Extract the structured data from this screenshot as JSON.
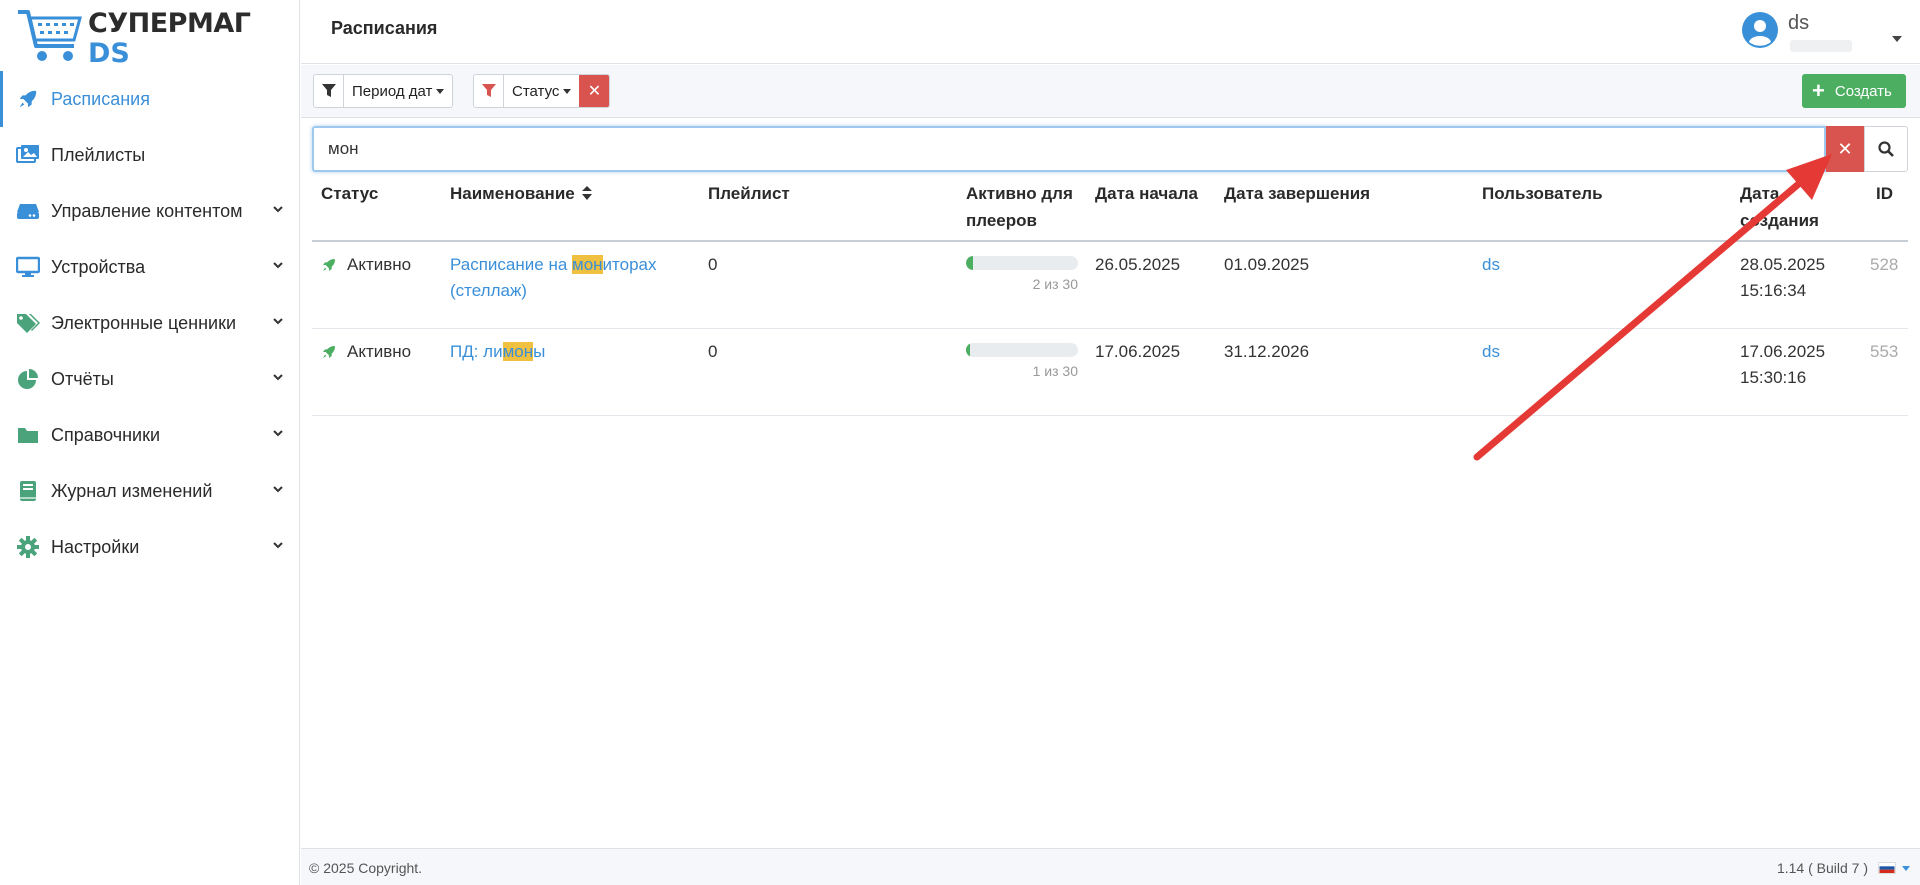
{
  "logo": {
    "line1": "СУПЕРМАГ",
    "line2": "DS"
  },
  "sidebar": {
    "items": [
      {
        "label": "Расписания",
        "icon": "rocket-icon",
        "active": true,
        "has_chevron": false
      },
      {
        "label": "Плейлисты",
        "icon": "images-icon",
        "active": false,
        "has_chevron": false
      },
      {
        "label": "Управление контентом",
        "icon": "drive-icon",
        "active": false,
        "has_chevron": true
      },
      {
        "label": "Устройства",
        "icon": "monitor-icon",
        "active": false,
        "has_chevron": true
      },
      {
        "label": "Электронные ценники",
        "icon": "tags-icon",
        "active": false,
        "has_chevron": true
      },
      {
        "label": "Отчёты",
        "icon": "pie-chart-icon",
        "active": false,
        "has_chevron": true
      },
      {
        "label": "Справочники",
        "icon": "folder-icon",
        "active": false,
        "has_chevron": true
      },
      {
        "label": "Журнал изменений",
        "icon": "book-icon",
        "active": false,
        "has_chevron": true
      },
      {
        "label": "Настройки",
        "icon": "gear-icon",
        "active": false,
        "has_chevron": true
      }
    ]
  },
  "header": {
    "title": "Расписания",
    "user_name": "ds"
  },
  "toolbar": {
    "filter_period_label": "Период дат",
    "filter_status_label": "Статус",
    "create_label": "Создать"
  },
  "search": {
    "value": "мон",
    "placeholder": ""
  },
  "table": {
    "columns": {
      "status": "Статус",
      "name": "Наименование",
      "playlist": "Плейлист",
      "active_line1": "Активно для",
      "active_line2": "плееров",
      "start": "Дата начала",
      "end": "Дата завершения",
      "user": "Пользователь",
      "created_line1": "Дата",
      "created_line2": "создания",
      "id": "ID"
    },
    "rows": [
      {
        "status": "Активно",
        "name_pre": "Расписание на ",
        "name_hl": "мон",
        "name_post": "иторах",
        "name_line2": "(стеллаж)",
        "playlist": "0",
        "progress": 0.0667,
        "progress_text": "2 из 30",
        "start": "26.05.2025",
        "end": "01.09.2025",
        "user": "ds",
        "created_date": "28.05.2025",
        "created_time": "15:16:34",
        "id": "528"
      },
      {
        "status": "Активно",
        "name_pre": "ПД: ли",
        "name_hl": "мон",
        "name_post": "ы",
        "name_line2": "",
        "playlist": "0",
        "progress": 0.0333,
        "progress_text": "1 из 30",
        "start": "17.06.2025",
        "end": "31.12.2026",
        "user": "ds",
        "created_date": "17.06.2025",
        "created_time": "15:30:16",
        "id": "553"
      }
    ]
  },
  "footer": {
    "copyright": "© 2025 Copyright.",
    "version": "1.14 ( Build 7 )"
  },
  "colors": {
    "accent": "#3a8fd9",
    "success": "#4cae61",
    "danger": "#d9534f",
    "highlight": "#f0c040",
    "annotation_arrow": "#e53935"
  }
}
